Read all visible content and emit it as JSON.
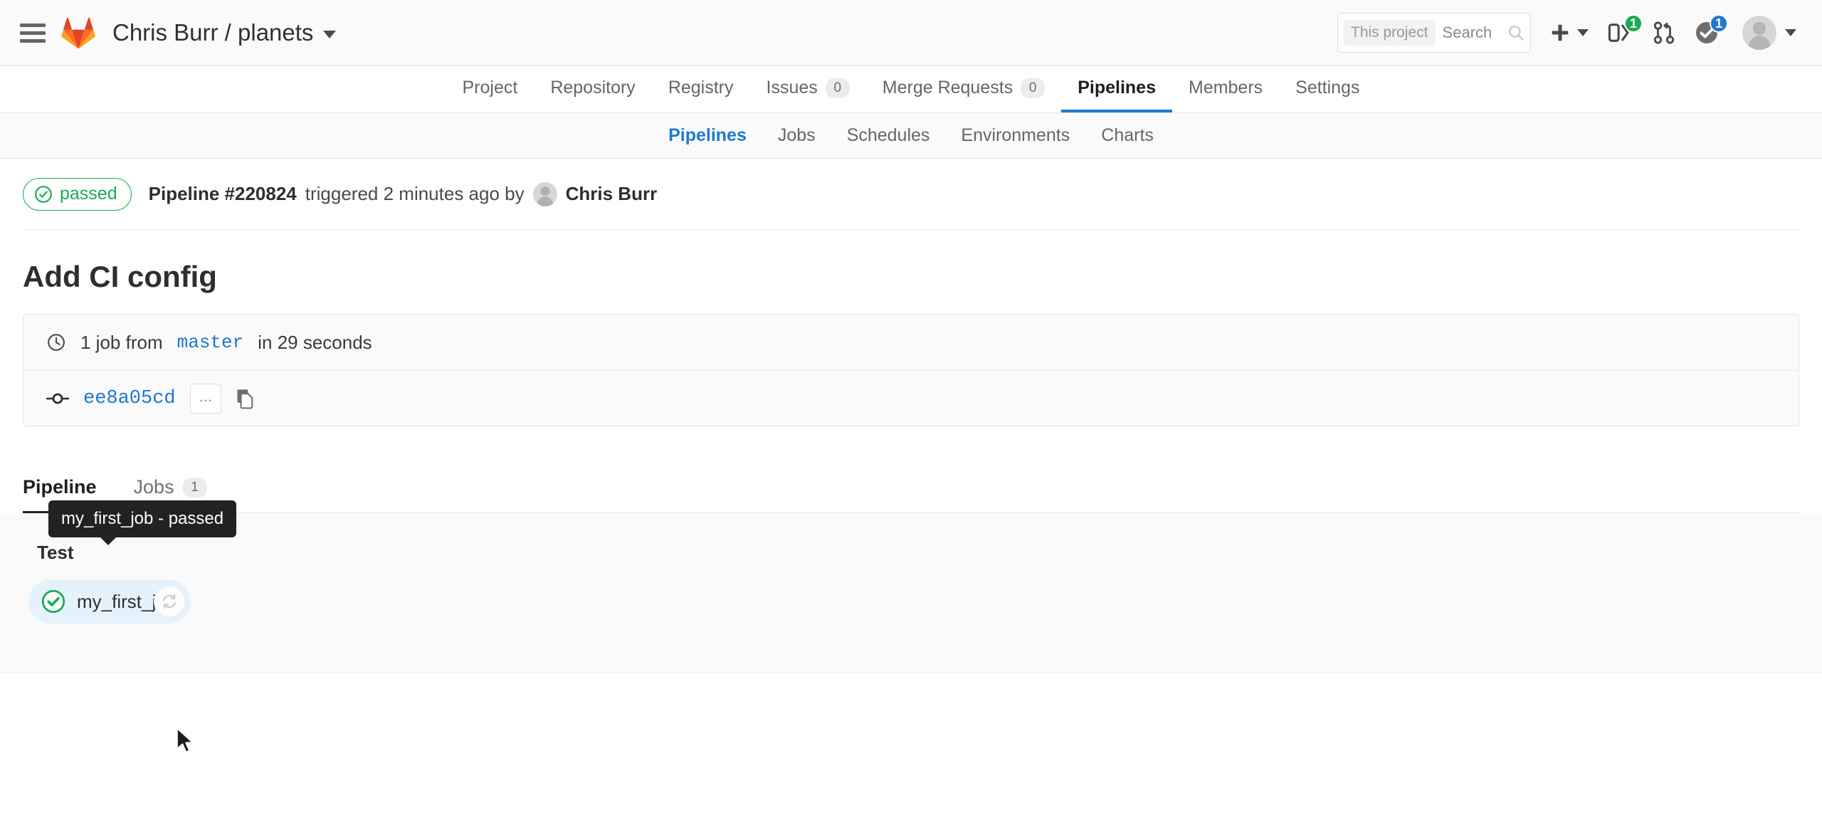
{
  "navbar": {
    "menu_icon": "hamburger-icon",
    "logo_icon": "gitlab-logo-icon",
    "project_path": "Chris Burr / planets",
    "search": {
      "scope_label": "This project",
      "placeholder": "Search",
      "value": "",
      "icon": "search-icon"
    },
    "actions": {
      "plus_label": "+",
      "issues_badge": "1",
      "todos_badge": "1"
    },
    "colors": {
      "badge_green": "#1aaa55",
      "badge_blue": "#1f78d1",
      "accent_blue": "#1f78d1"
    }
  },
  "main_nav": {
    "items": [
      {
        "label": "Project",
        "count": "",
        "active": false
      },
      {
        "label": "Repository",
        "count": "",
        "active": false
      },
      {
        "label": "Registry",
        "count": "",
        "active": false
      },
      {
        "label": "Issues",
        "count": "0",
        "active": false
      },
      {
        "label": "Merge Requests",
        "count": "0",
        "active": false
      },
      {
        "label": "Pipelines",
        "count": "",
        "active": true
      },
      {
        "label": "Members",
        "count": "",
        "active": false
      },
      {
        "label": "Settings",
        "count": "",
        "active": false
      }
    ]
  },
  "sub_nav": {
    "items": [
      {
        "label": "Pipelines",
        "active": true
      },
      {
        "label": "Jobs",
        "active": false
      },
      {
        "label": "Schedules",
        "active": false
      },
      {
        "label": "Environments",
        "active": false
      },
      {
        "label": "Charts",
        "active": false
      }
    ]
  },
  "pipeline_header": {
    "status": "passed",
    "status_color": "#1aaa55",
    "pipeline_id": "Pipeline #220824",
    "triggered_text": "triggered 2 minutes ago by",
    "author": "Chris Burr"
  },
  "commit": {
    "title": "Add CI config",
    "summary_prefix": "1 job from",
    "branch": "master",
    "summary_suffix": "in 29 seconds",
    "sha": "ee8a05cd",
    "expand_label": "...",
    "copy_icon": "copy-icon",
    "clock_icon": "clock-icon",
    "commit_icon": "commit-node-icon"
  },
  "tabs": [
    {
      "label": "Pipeline",
      "count": "",
      "active": true
    },
    {
      "label": "Jobs",
      "count": "1",
      "active": false
    }
  ],
  "graph": {
    "stage_label": "Test",
    "job": {
      "name": "my_first_job",
      "status": "passed",
      "status_icon": "status-success-icon",
      "retry_icon": "retry-icon"
    },
    "tooltip": "my_first_job - passed"
  }
}
